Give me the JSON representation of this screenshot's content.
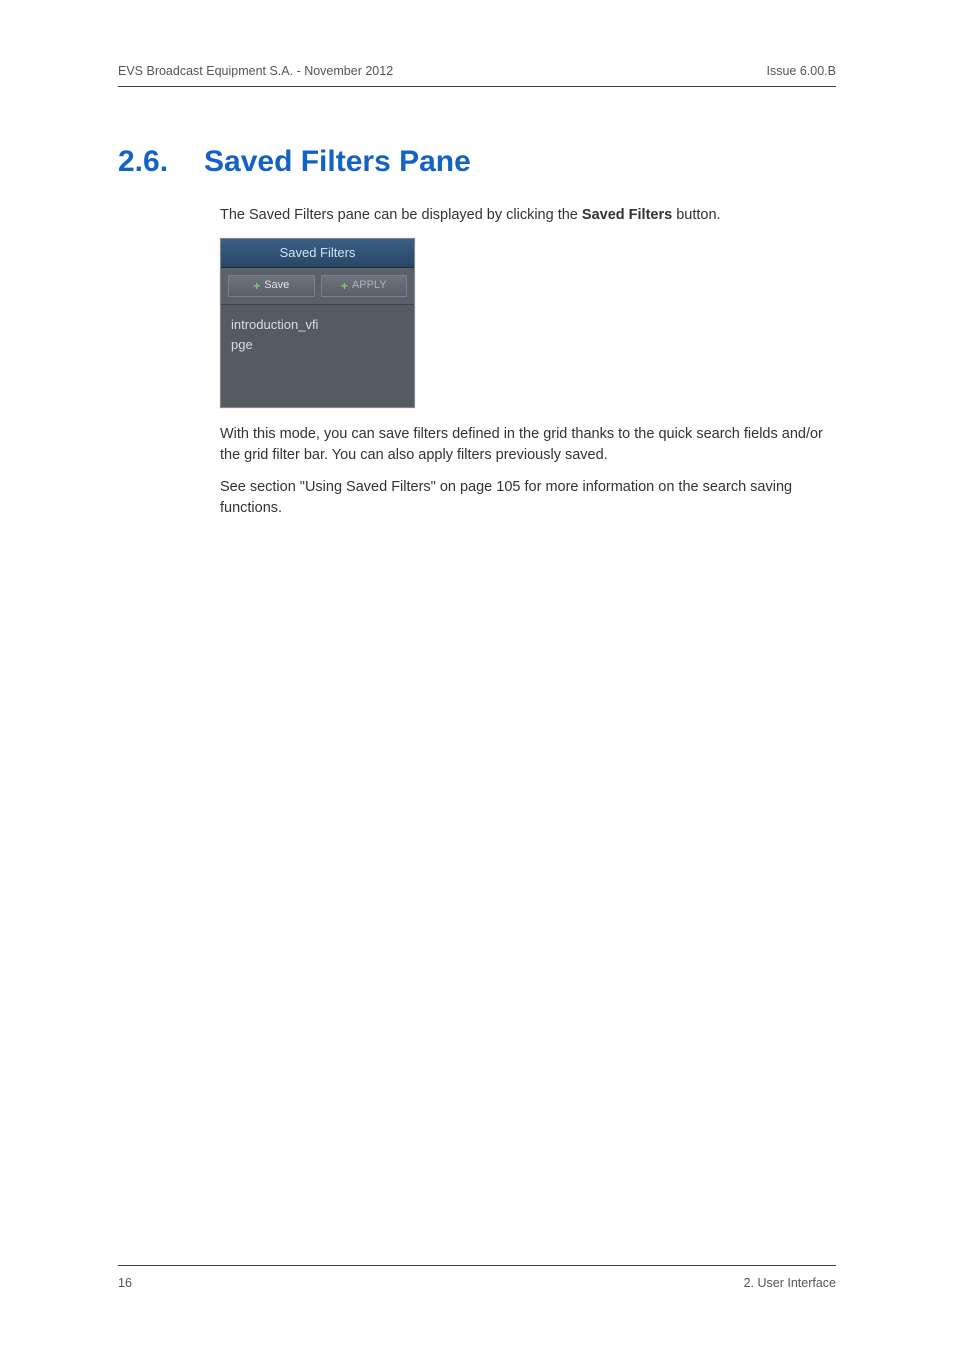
{
  "header": {
    "left": "EVS Broadcast Equipment S.A.  - November 2012",
    "right": "Issue 6.00.B"
  },
  "section": {
    "number": "2.6.",
    "title": "Saved Filters Pane"
  },
  "intro_before": "The Saved Filters pane can be displayed by clicking the ",
  "intro_bold": "Saved Filters",
  "intro_after": " button.",
  "panel": {
    "title": "Saved Filters",
    "save_label": "Save",
    "apply_label": "APPLY",
    "items": [
      "introduction_vfi",
      "pge"
    ]
  },
  "para2": "With this mode, you can save filters defined in the grid thanks to the quick search fields and/or the grid filter bar. You can also apply filters previously saved.",
  "para3": "See section \"Using Saved Filters\" on page 105 for more information on the search saving functions.",
  "footer": {
    "left": "16",
    "right": "2. User Interface"
  }
}
